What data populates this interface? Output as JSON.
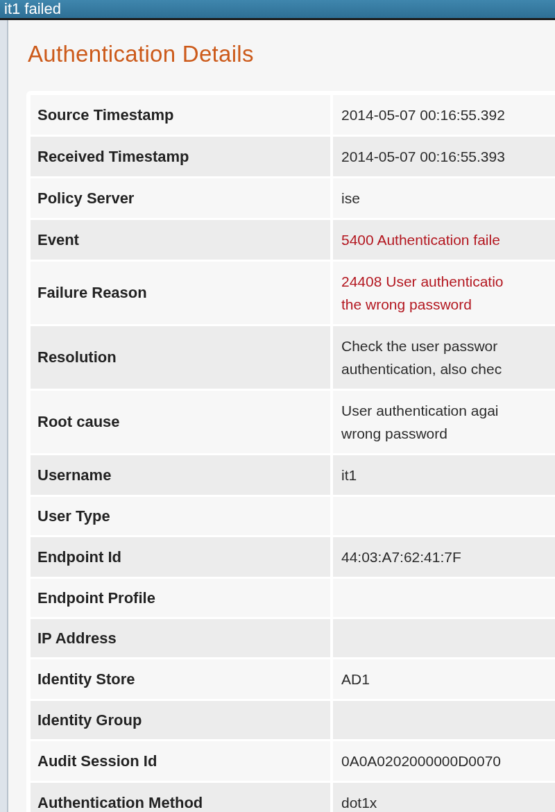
{
  "window": {
    "title": "it1 failed"
  },
  "heading": "Authentication Details",
  "rows": [
    {
      "label": "Source Timestamp",
      "kind": "plain",
      "lines": [
        "2014-05-07 00:16:55.392"
      ]
    },
    {
      "label": "Received Timestamp",
      "kind": "plain",
      "lines": [
        "2014-05-07 00:16:55.393"
      ]
    },
    {
      "label": "Policy Server",
      "kind": "plain",
      "lines": [
        "ise"
      ]
    },
    {
      "label": "Event",
      "kind": "error",
      "lines": [
        "5400 Authentication faile"
      ]
    },
    {
      "label": "Failure Reason",
      "kind": "error",
      "lines": [
        "24408 User authenticatio",
        "the wrong password"
      ]
    },
    {
      "label": "Resolution",
      "kind": "plain",
      "lines": [
        "Check the user passwor",
        "authentication, also chec"
      ]
    },
    {
      "label": "Root cause",
      "kind": "plain",
      "lines": [
        "User authentication agai",
        "wrong password"
      ]
    },
    {
      "label": "Username",
      "kind": "plain",
      "lines": [
        "it1"
      ]
    },
    {
      "label": "User Type",
      "kind": "plain",
      "lines": []
    },
    {
      "label": "Endpoint Id",
      "kind": "plain",
      "lines": [
        "44:03:A7:62:41:7F"
      ]
    },
    {
      "label": "Endpoint Profile",
      "kind": "plain",
      "lines": []
    },
    {
      "label": "IP Address",
      "kind": "plain",
      "lines": []
    },
    {
      "label": "Identity Store",
      "kind": "plain",
      "lines": [
        "AD1"
      ]
    },
    {
      "label": "Identity Group",
      "kind": "plain",
      "lines": []
    },
    {
      "label": "Audit Session Id",
      "kind": "plain",
      "lines": [
        "0A0A0202000000D0070"
      ]
    },
    {
      "label": "Authentication Method",
      "kind": "plain",
      "lines": [
        "dot1x"
      ]
    }
  ]
}
